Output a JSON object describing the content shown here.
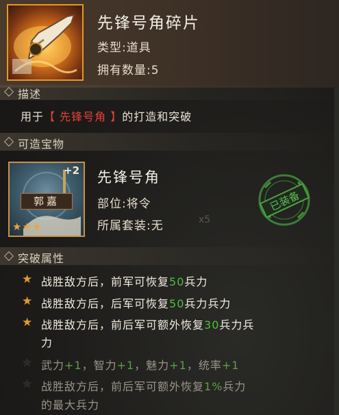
{
  "item": {
    "name": "先锋号角碎片",
    "type_line": "类型:道具",
    "count_line": "拥有数量:5"
  },
  "description": {
    "section_label": "描述",
    "prefix": "用于",
    "highlight": "【 先锋号角 】",
    "suffix": "的打造和突破"
  },
  "craftable": {
    "section_label": "可造宝物",
    "name": "先锋号角",
    "part_line": "部位:将令",
    "set_line": "所属套装:无",
    "general": "郭嘉",
    "level": "+2",
    "stars": "★★★",
    "stamp_text": "已装备",
    "faded_count": "x5",
    "faded_text": "..."
  },
  "breakthrough": {
    "section_label": "突破属性",
    "attrs": [
      {
        "pre": "战胜敌方后，前军可恢复",
        "value": "50",
        "post": "兵力"
      },
      {
        "pre": "战胜敌方后，后军可恢复",
        "value": "50",
        "post": "兵力兵力"
      },
      {
        "pre": "战胜敌方后，前后军可额外恢复",
        "value": "30",
        "post": "兵力兵",
        "line2": "力"
      },
      {
        "t1": "武力",
        "v1": "+1",
        "t2": "，智力",
        "v2": "+1",
        "t3": "，魅力",
        "v3": "+1",
        "t4": "，统率",
        "v4": "+1"
      },
      {
        "pre": "战胜敌方后，前后军可额外恢复",
        "value": "1%",
        "post": "兵力",
        "line2": "的最大兵力"
      }
    ]
  },
  "colors": {
    "accent_orange": "#e39a2b",
    "highlight_red": "#e8403a",
    "value_green": "#4fbf3a",
    "stamp_green": "#3f8f3a"
  }
}
